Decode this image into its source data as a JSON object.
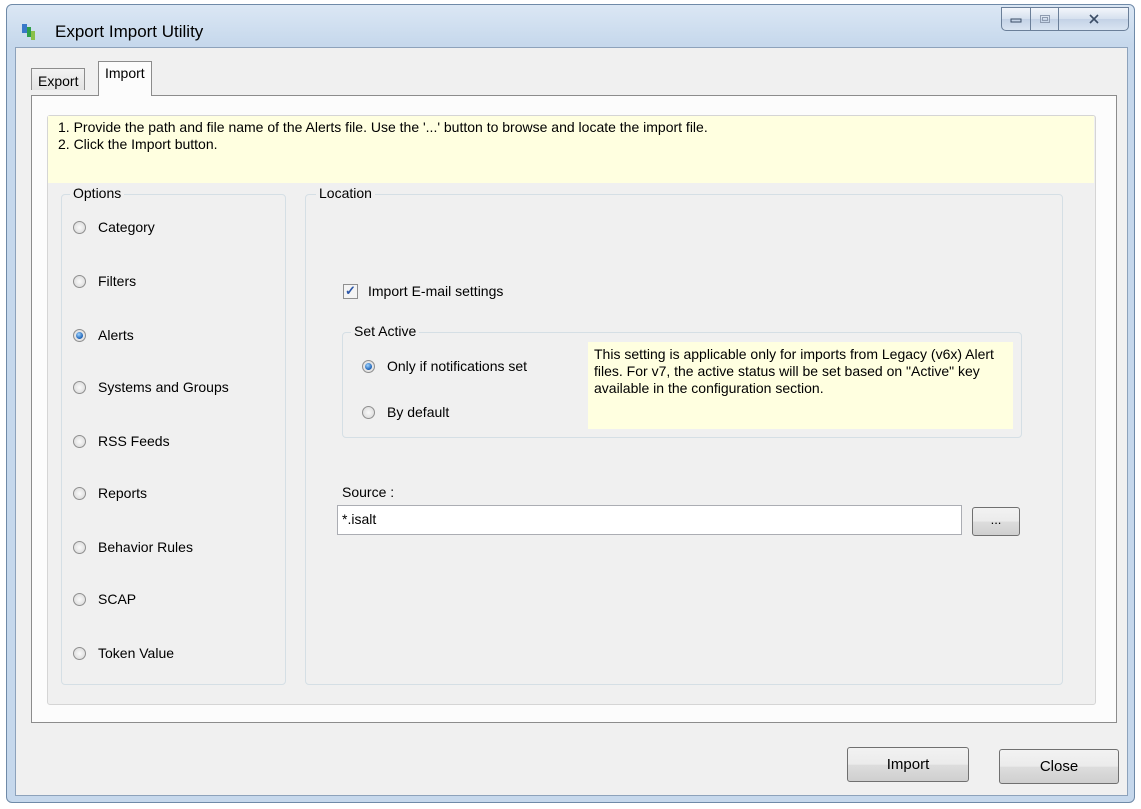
{
  "window": {
    "title": "Export Import Utility",
    "icon": "app-icon",
    "controls": {
      "minimize": "minimize-icon",
      "maximize": "maximize-icon",
      "close": "close-icon"
    }
  },
  "tabs": [
    {
      "label": "Export",
      "active": false
    },
    {
      "label": "Import",
      "active": true
    }
  ],
  "instructions": {
    "line1": "1. Provide the path and file name of the Alerts file. Use the '...' button to browse and locate the import file.",
    "line2": "2. Click the Import button."
  },
  "options": {
    "legend": "Options",
    "items": [
      {
        "label": "Category",
        "checked": false
      },
      {
        "label": "Filters",
        "checked": false
      },
      {
        "label": "Alerts",
        "checked": true
      },
      {
        "label": "Systems and Groups",
        "checked": false
      },
      {
        "label": "RSS Feeds",
        "checked": false
      },
      {
        "label": "Reports",
        "checked": false
      },
      {
        "label": "Behavior Rules",
        "checked": false
      },
      {
        "label": "SCAP",
        "checked": false
      },
      {
        "label": "Token Value",
        "checked": false
      }
    ]
  },
  "location": {
    "legend": "Location",
    "import_email": {
      "label": "Import E-mail settings",
      "checked": true
    },
    "set_active": {
      "legend": "Set Active",
      "options": [
        {
          "label": "Only if notifications set",
          "checked": true
        },
        {
          "label": "By default",
          "checked": false
        }
      ],
      "note": "This setting is applicable only for imports from Legacy (v6x) Alert files. For v7, the active status will be set based on \"Active\" key available in the configuration section."
    },
    "source": {
      "label": "Source :",
      "value": "*.isalt",
      "browse_label": "..."
    }
  },
  "footer": {
    "import_label": "Import",
    "close_label": "Close"
  },
  "colors": {
    "info_background": "#ffffe0",
    "radio_selected": "#1a5fb4",
    "check_mark": "#2d57a8"
  }
}
